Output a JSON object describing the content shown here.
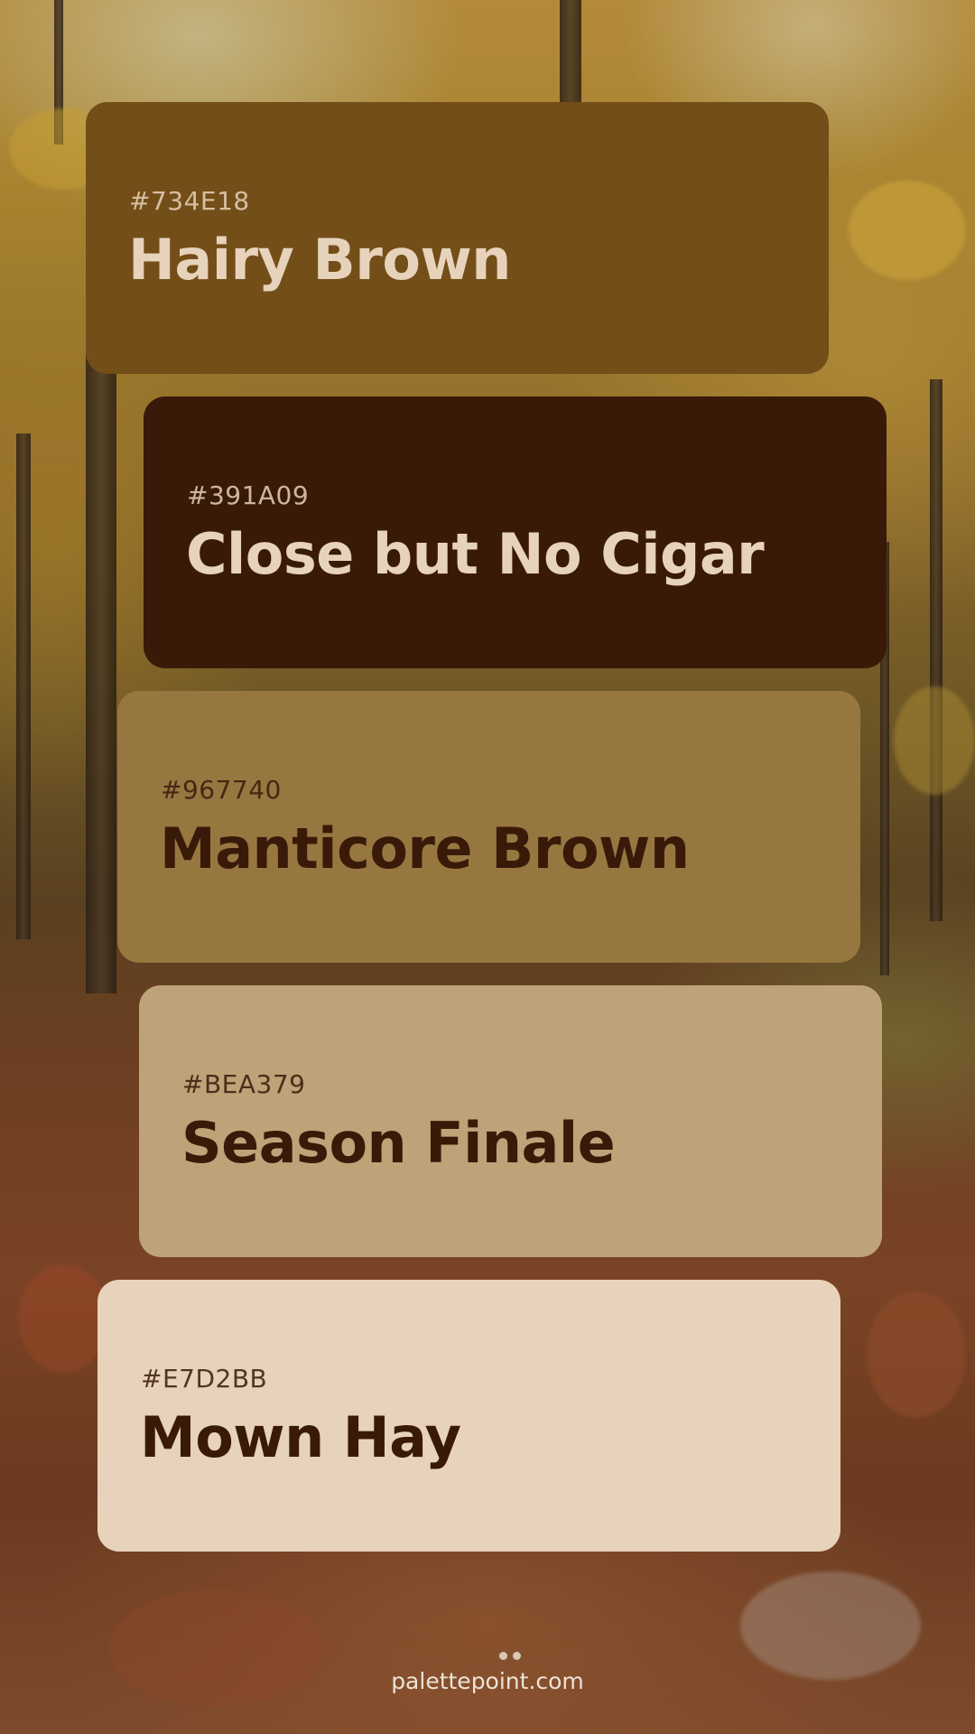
{
  "palette": [
    {
      "hex": "#734E18",
      "name": "Hairy Brown",
      "color": "#734E18",
      "text_color": "#E7D2BB"
    },
    {
      "hex": "#391A09",
      "name": "Close but No Cigar",
      "color": "#391A09",
      "text_color": "#E7D2BB"
    },
    {
      "hex": "#967740",
      "name": "Manticore Brown",
      "color": "#967740",
      "text_color": "#391A09"
    },
    {
      "hex": "#BEA379",
      "name": "Season Finale",
      "color": "#BEA379",
      "text_color": "#391A09"
    },
    {
      "hex": "#E7D2BB",
      "name": "Mown Hay",
      "color": "#E7D2BB",
      "text_color": "#391A09"
    }
  ],
  "footer": {
    "site": "palettepoint.com",
    "dot_count": 2
  },
  "background": {
    "description_icon": "autumn-forest-photo"
  }
}
